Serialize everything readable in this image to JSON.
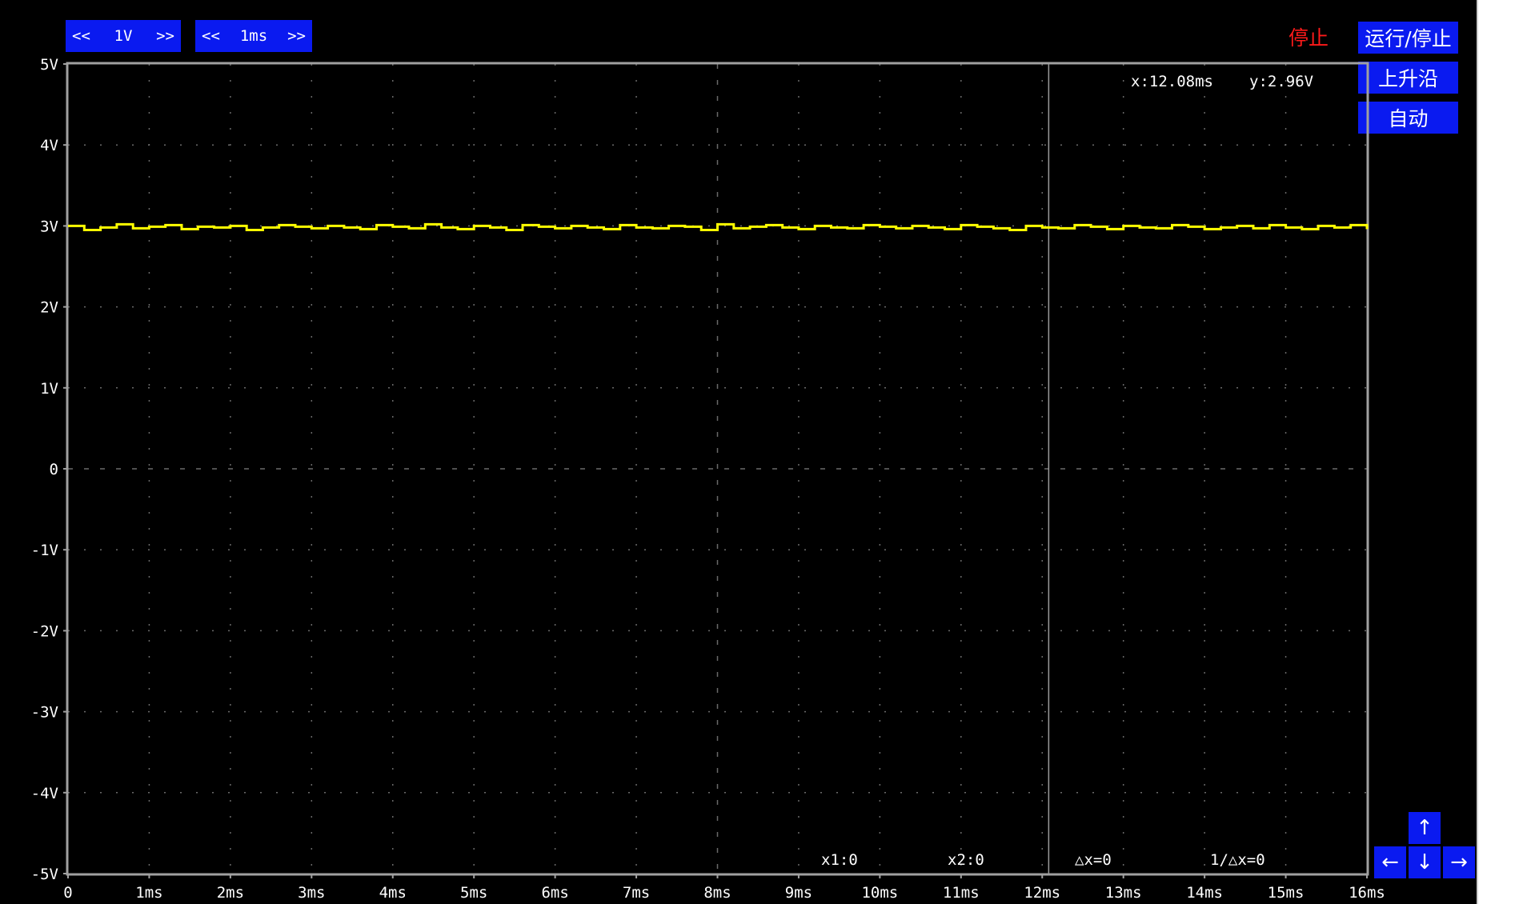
{
  "toolbar": {
    "volt_dec": "<<",
    "volt_value": "1V",
    "volt_inc": ">>",
    "time_dec": "<<",
    "time_value": "1ms",
    "time_inc": ">>"
  },
  "status_text": "停止",
  "side_buttons": {
    "run_stop": "运行/停止",
    "rising_edge": "上升沿",
    "auto": "自动"
  },
  "arrows": {
    "up": "↑",
    "left": "←",
    "down": "↓",
    "right": "→"
  },
  "cursor_readout": {
    "x": "x:12.08ms",
    "y": "y:2.96V"
  },
  "measurements": {
    "x1": "x1:0",
    "x2": "x2:0",
    "dx": "△x=0",
    "inv_dx": "1/△x=0"
  },
  "colors": {
    "background": "#000000",
    "trace": "#ffff00",
    "button": "#0a1af0",
    "status": "#ff1a1a",
    "frame": "#a0a0a0"
  },
  "chart_data": {
    "type": "line",
    "y_tick_labels": [
      "5V",
      "4V",
      "3V",
      "2V",
      "1V",
      "0",
      "-1V",
      "-2V",
      "-3V",
      "-4V",
      "-5V"
    ],
    "x_tick_labels": [
      "0",
      "1ms",
      "2ms",
      "3ms",
      "4ms",
      "5ms",
      "6ms",
      "7ms",
      "8ms",
      "9ms",
      "10ms",
      "11ms",
      "12ms",
      "13ms",
      "14ms",
      "15ms",
      "16ms"
    ],
    "xlim": [
      0,
      16
    ],
    "ylim": [
      -5,
      5
    ],
    "grid": true,
    "cursor_x": 12.08,
    "series": [
      {
        "color": "#ffff00",
        "x": [
          0,
          0.2,
          0.4,
          0.6,
          0.8,
          1,
          1.2,
          1.4,
          1.6,
          1.8,
          2,
          2.2,
          2.4,
          2.6,
          2.8,
          3,
          3.2,
          3.4,
          3.6,
          3.8,
          4,
          4.2,
          4.4,
          4.6,
          4.8,
          5,
          5.2,
          5.4,
          5.6,
          5.8,
          6,
          6.2,
          6.4,
          6.6,
          6.8,
          7,
          7.2,
          7.4,
          7.6,
          7.8,
          8,
          8.2,
          8.4,
          8.6,
          8.8,
          9,
          9.2,
          9.4,
          9.6,
          9.8,
          10,
          10.2,
          10.4,
          10.6,
          10.8,
          11,
          11.2,
          11.4,
          11.6,
          11.8,
          12,
          12.2,
          12.4,
          12.6,
          12.8,
          13,
          13.2,
          13.4,
          13.6,
          13.8,
          14,
          14.2,
          14.4,
          14.6,
          14.8,
          15,
          15.2,
          15.4,
          15.6,
          15.8,
          16
        ],
        "values": [
          3.0,
          2.95,
          2.98,
          3.02,
          2.97,
          2.99,
          3.01,
          2.96,
          2.99,
          2.98,
          3.0,
          2.95,
          2.98,
          3.01,
          2.99,
          2.97,
          3.0,
          2.98,
          2.96,
          3.01,
          2.99,
          2.97,
          3.02,
          2.98,
          2.96,
          3.0,
          2.98,
          2.95,
          3.01,
          2.99,
          2.97,
          3.0,
          2.98,
          2.96,
          3.01,
          2.98,
          2.97,
          3.0,
          2.99,
          2.95,
          3.02,
          2.97,
          2.99,
          3.01,
          2.98,
          2.96,
          3.0,
          2.98,
          2.97,
          3.01,
          2.99,
          2.97,
          3.0,
          2.98,
          2.96,
          3.01,
          2.99,
          2.97,
          2.95,
          3.0,
          2.98,
          2.97,
          3.01,
          2.99,
          2.96,
          3.0,
          2.98,
          2.97,
          3.01,
          2.99,
          2.96,
          2.98,
          3.0,
          2.97,
          3.01,
          2.98,
          2.96,
          3.0,
          2.98,
          3.01,
          2.96
        ]
      }
    ]
  }
}
